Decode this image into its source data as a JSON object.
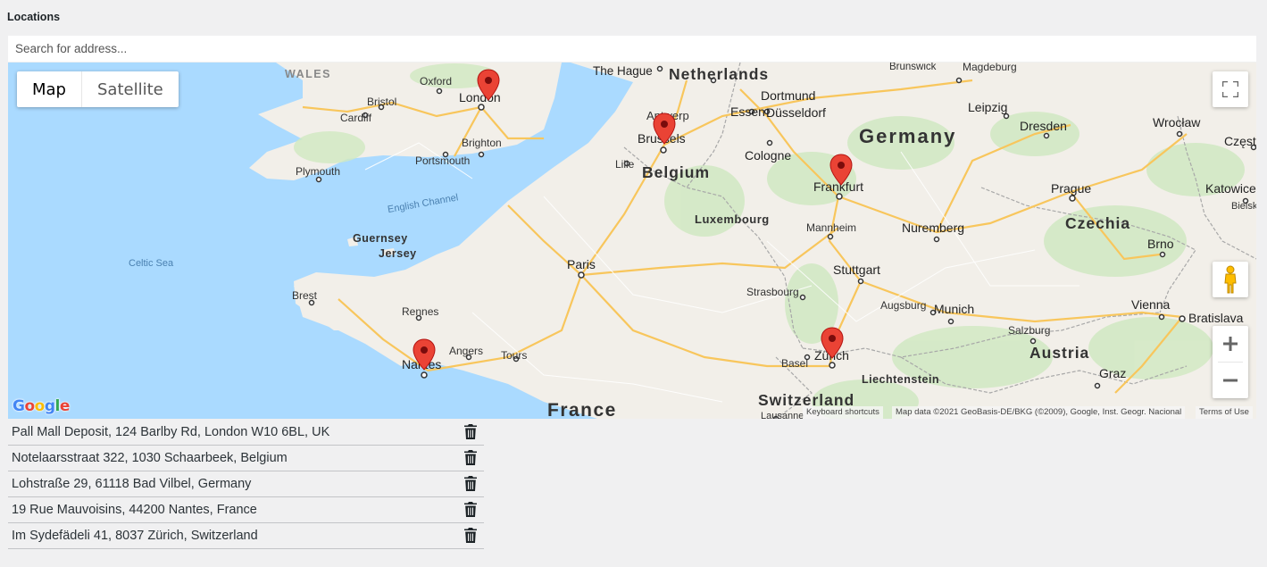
{
  "field": {
    "label": "Locations",
    "search_placeholder": "Search for address..."
  },
  "map": {
    "type_buttons": [
      "Map",
      "Satellite"
    ],
    "active_type": "Map",
    "logo": "Google",
    "keyboard_shortcuts": "Keyboard shortcuts",
    "map_data": "Map data ©2021 GeoBasis-DE/BKG (©2009), Google, Inst. Geogr. Nacional",
    "terms": "Terms of Use",
    "labels": {
      "wales": "WALES",
      "oxford": "Oxford",
      "bristol": "Bristol",
      "cardiff": "Cardiff",
      "london": "London",
      "brighton": "Brighton",
      "portsmouth": "Portsmouth",
      "plymouth": "Plymouth",
      "english_channel": "English Channel",
      "celtic_sea": "Celtic Sea",
      "guernsey": "Guernsey",
      "jersey": "Jersey",
      "brest": "Brest",
      "rennes": "Rennes",
      "nantes": "Nantes",
      "angers": "Angers",
      "tours": "Tours",
      "france": "France",
      "paris": "Paris",
      "the_hague": "The Hague",
      "netherlands": "Netherlands",
      "antwerp": "Antwerp",
      "brussels": "Brussels",
      "belgium": "Belgium",
      "lille": "Lille",
      "luxembourg": "Luxembourg",
      "brunswick": "Brunswick",
      "magdeburg": "Magdeburg",
      "dortmund": "Dortmund",
      "essen": "Essen",
      "dusseldorf": "Düsseldorf",
      "cologne": "Cologne",
      "germany": "Germany",
      "leipzig": "Leipzig",
      "dresden": "Dresden",
      "wroclaw": "Wrocław",
      "czest": "Częst",
      "frankfurt": "Frankfurt",
      "prague": "Prague",
      "katowice": "Katowice",
      "bielsk": "Bielsk",
      "czechia": "Czechia",
      "mannheim": "Mannheim",
      "nuremberg": "Nuremberg",
      "brno": "Brno",
      "stuttgart": "Stuttgart",
      "strasbourg": "Strasbourg",
      "augsburg": "Augsburg",
      "munich": "Munich",
      "vienna": "Vienna",
      "bratislava": "Bratislava",
      "salzburg": "Salzburg",
      "austria": "Austria",
      "zurich": "Zürich",
      "basel": "Basel",
      "graz": "Graz",
      "liechtenstein": "Liechtenstein",
      "switzerland": "Switzerland",
      "lausanne": "Lausanne"
    }
  },
  "locations": [
    "Pall Mall Deposit, 124 Barlby Rd, London W10 6BL, UK",
    "Notelaarsstraat 322, 1030 Schaarbeek, Belgium",
    "Lohstraße 29, 61118 Bad Vilbel, Germany",
    "19 Rue Mauvoisins, 44200 Nantes, France",
    "Im Sydefädeli 41, 8037 Zürich, Switzerland"
  ],
  "colors": {
    "water": "#aadaff",
    "land": "#f2efe9",
    "green": "#cfe8c0",
    "motorway": "#f8c65c",
    "border": "#9e9e9e",
    "marker": "#ea4335"
  },
  "icons": {
    "fullscreen": "fullscreen-icon",
    "pegman": "pegman-icon",
    "zoom_in": "plus-icon",
    "zoom_out": "minus-icon",
    "delete": "trash-icon",
    "marker": "map-pin-icon"
  }
}
